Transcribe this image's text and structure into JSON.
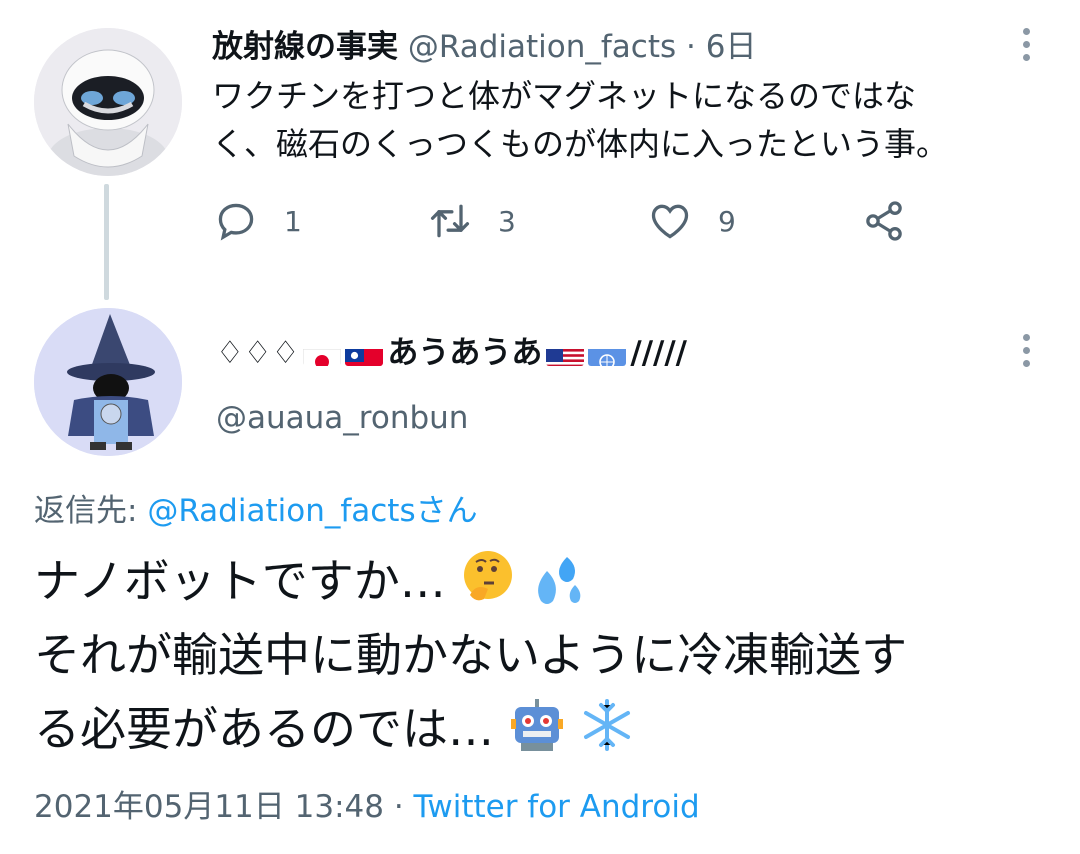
{
  "tweet1": {
    "name": "放射線の事実",
    "handle": "@Radiation_facts",
    "time": "6日",
    "text_line1": "ワクチンを打つと体がマグネットになるのではな",
    "text_line2": "く、磁石のくっつくものが体内に入ったという事。",
    "replies": "1",
    "retweets": "3",
    "likes": "9"
  },
  "reply": {
    "name_prefix": "♢♢♢",
    "name_mid": "あうあうあ",
    "name_suffix": "/////",
    "handle": "@auaua_ronbun",
    "reply_to_label": "返信先: ",
    "reply_to_link": "@Radiation_factsさん",
    "line1": "ナノボットですか…",
    "line2": "それが輸送中に動かないように冷凍輸送す",
    "line3": "る必要があるのでは…",
    "date": "2021年05月11日 13:48",
    "sep": " · ",
    "client": "Twitter for Android"
  },
  "colors": {
    "link": "#1d9bf0",
    "secondary": "#536471",
    "thread_line": "#cfd9de"
  },
  "icons": [
    "more-icon",
    "reply-icon",
    "retweet-icon",
    "like-icon",
    "share-icon",
    "thinking-face-emoji",
    "sweat-drops-emoji",
    "robot-emoji",
    "snowflake-emoji"
  ]
}
